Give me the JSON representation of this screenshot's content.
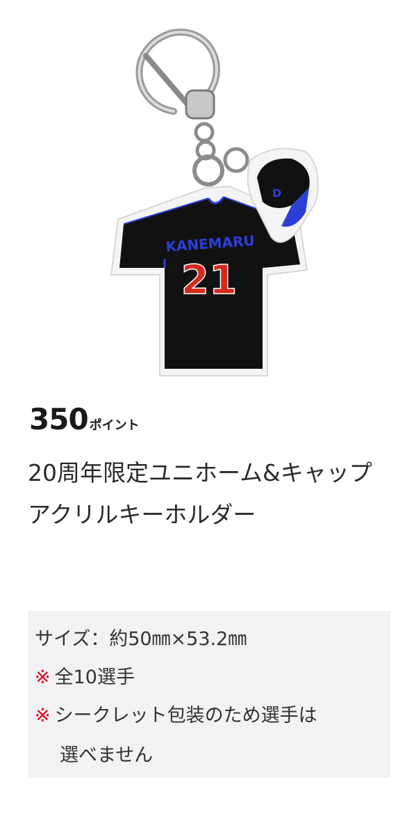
{
  "product": {
    "image_label": "KANEMARU",
    "jersey_number": "21",
    "price_value": "350",
    "price_unit": "ポイント",
    "title": "20周年限定ユニホーム&キャップアクリルキーホルダー"
  },
  "details": {
    "size_line": "サイズ：約50㎜×53.2㎜",
    "note_mark": "※",
    "note_1": "全10選手",
    "note_2_line1": "シークレット包装のため選手は",
    "note_2_line2": "選べません"
  },
  "colors": {
    "note_mark": "#e0001b",
    "info_background": "#f2f2f2",
    "jersey": "#111111",
    "jersey_trim": "#2b3fd6",
    "number": "#d42a1e"
  }
}
